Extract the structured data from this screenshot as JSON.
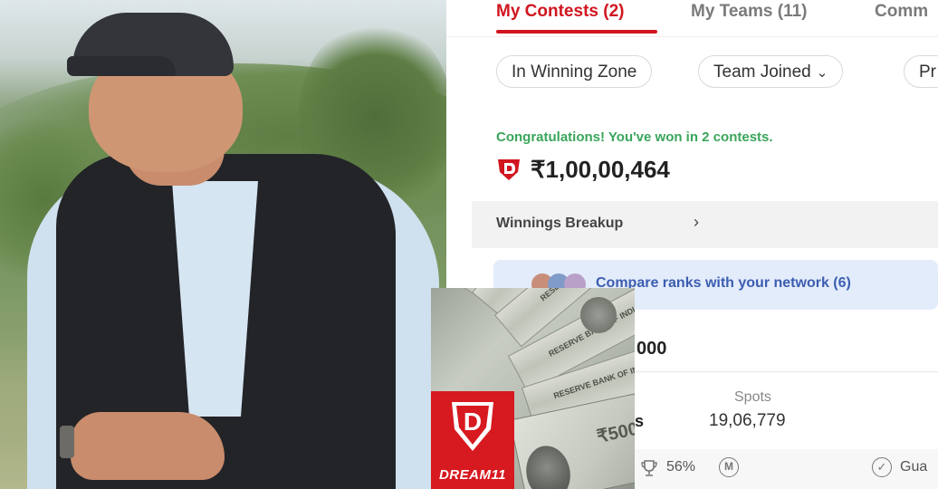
{
  "app": {
    "tabs": [
      {
        "label": "My Contests (2)",
        "active": true
      },
      {
        "label": "My Teams (11)",
        "active": false
      },
      {
        "label": "Comm",
        "active": false
      }
    ],
    "filters": [
      {
        "label": "In Winning Zone"
      },
      {
        "label": "Team Joined",
        "icon": "chevron-down-icon"
      },
      {
        "label": "Pr"
      }
    ],
    "congrats_text": "Congratulations! You've won in 2 contests.",
    "winnings_amount": "₹1,00,00,464",
    "winnings_breakup_label": "Winnings Breakup",
    "compare_label": "Compare ranks with your network (6)",
    "prize_fragment": "000",
    "row_fragment": "s",
    "spots_label": "Spots",
    "spots_value": "19,06,779",
    "footer": {
      "win_percent": "56%",
      "m_badge": "M",
      "guaranteed_fragment": "Gua"
    }
  },
  "overlay": {
    "logo_text": "DREAM11",
    "logo_letter": "D",
    "note_text": "RESERVE BANK OF INDIA",
    "note_denomination": "₹500"
  },
  "colors": {
    "brand_red": "#d0161f",
    "logo_red": "#d71920",
    "success_green": "#3aa55b",
    "compare_blue": "#3c5db0",
    "compare_bg": "#e3ecfb"
  }
}
